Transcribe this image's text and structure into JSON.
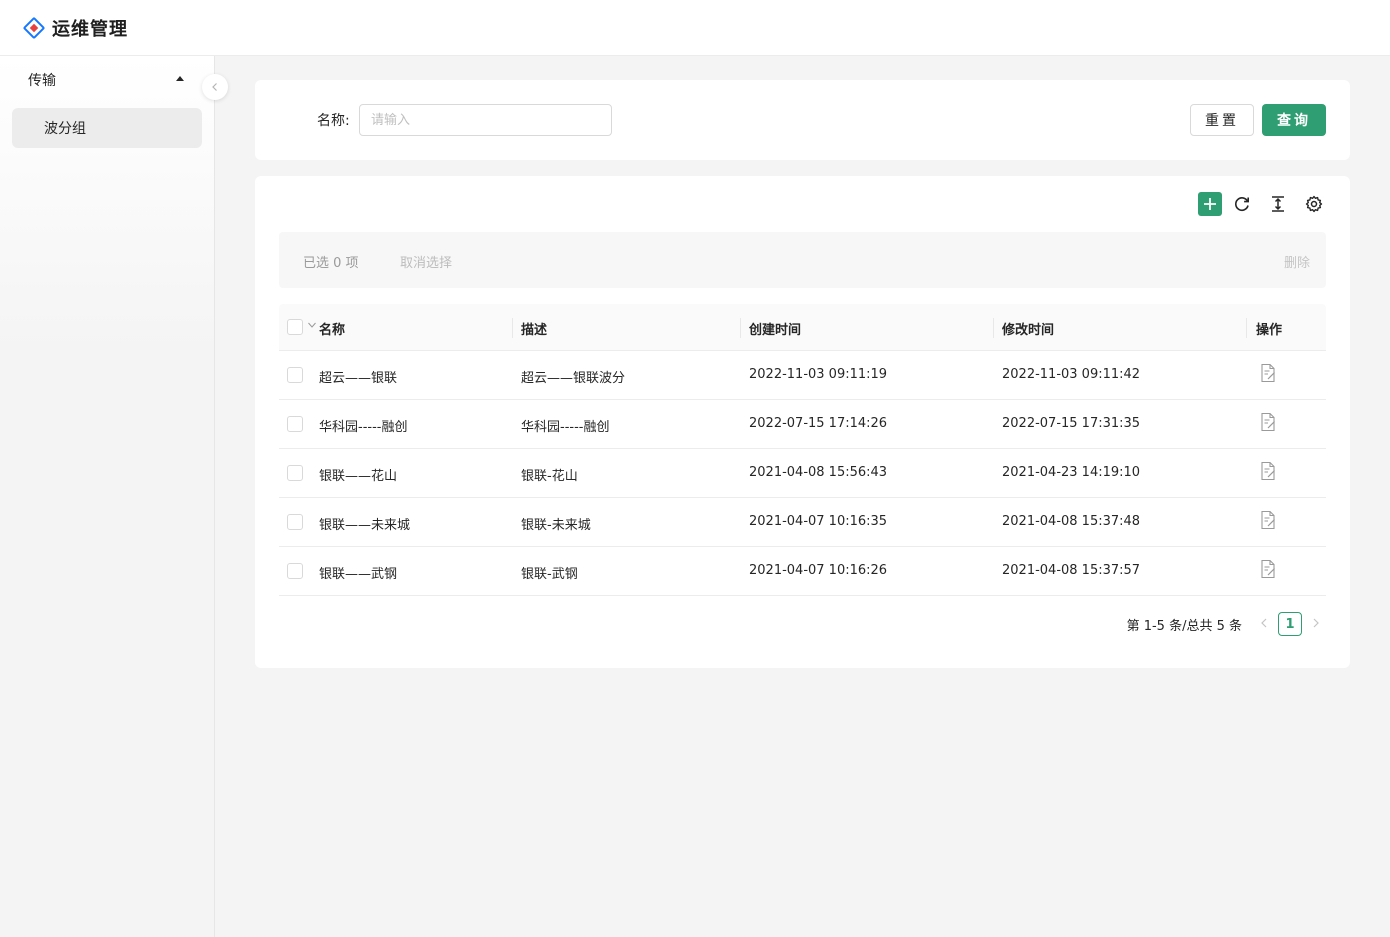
{
  "app": {
    "title": "运维管理",
    "brand_color": "#1677ff",
    "accent": "#2f9e72"
  },
  "sidebar": {
    "group_label": "传输",
    "items": [
      {
        "label": "波分组",
        "active": true
      }
    ]
  },
  "search": {
    "name_label": "名称:",
    "name_placeholder": "请输入",
    "reset_label": "重置",
    "query_label": "查询"
  },
  "toolbar": {
    "icons": [
      "plus-icon",
      "refresh-icon",
      "density-icon",
      "settings-icon"
    ]
  },
  "selection": {
    "count_text": "已选 0 项",
    "cancel_label": "取消选择",
    "delete_label": "删除"
  },
  "table": {
    "columns": [
      "名称",
      "描述",
      "创建时间",
      "修改时间",
      "操作"
    ],
    "rows": [
      {
        "name": "超云——银联",
        "desc": "超云——银联波分",
        "created": "2022-11-03 09:11:19",
        "modified": "2022-11-03 09:11:42"
      },
      {
        "name": "华科园-----融创",
        "desc": "华科园-----融创",
        "created": "2022-07-15 17:14:26",
        "modified": "2022-07-15 17:31:35"
      },
      {
        "name": "银联——花山",
        "desc": "银联-花山",
        "created": "2021-04-08 15:56:43",
        "modified": "2021-04-23 14:19:10"
      },
      {
        "name": "银联——未来城",
        "desc": "银联-未来城",
        "created": "2021-04-07 10:16:35",
        "modified": "2021-04-08 15:37:48"
      },
      {
        "name": "银联——武钢",
        "desc": "银联-武钢",
        "created": "2021-04-07 10:16:26",
        "modified": "2021-04-08 15:37:57"
      }
    ]
  },
  "pagination": {
    "total_text": "第 1-5 条/总共 5 条",
    "current_page": "1"
  }
}
